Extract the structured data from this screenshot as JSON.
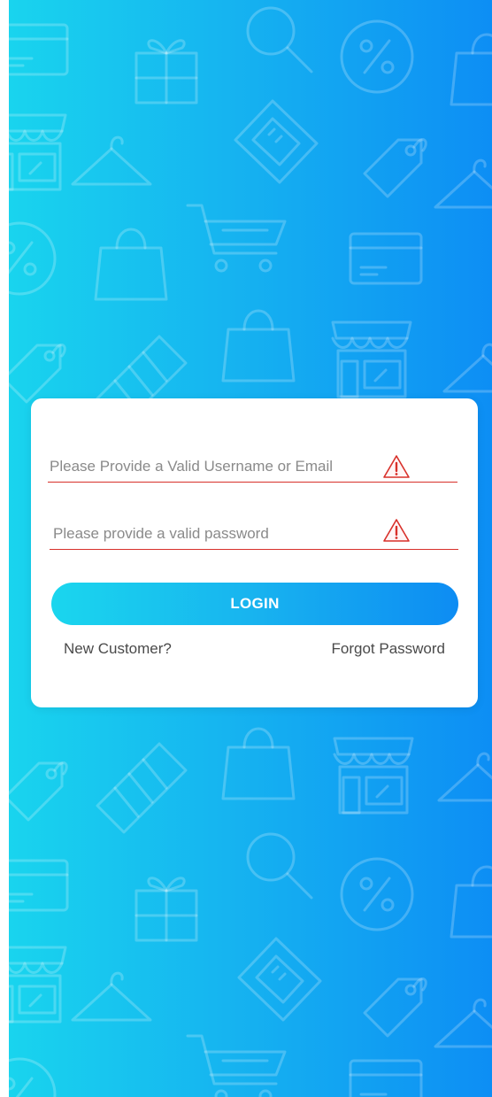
{
  "colors": {
    "background_start": "#19d4ee",
    "background_end": "#0d8ef4",
    "card": "#ffffff",
    "error_underline": "#d8302a",
    "button_start": "#1ad6ee",
    "button_end": "#0d8cf3",
    "link_text": "#4a4a4a"
  },
  "background": {
    "pattern_icons": [
      "credit-card-icon",
      "gift-icon",
      "magnifier-icon",
      "percent-badge-icon",
      "shopping-bag-icon",
      "storefront-icon",
      "clothes-hanger-icon",
      "laptop-icon",
      "price-tag-icon",
      "shopping-cart-icon",
      "striped-tag-icon"
    ]
  },
  "login_form": {
    "username": {
      "value": "",
      "placeholder": "Please Provide a Valid Username or Email",
      "status_icon": "warning-triangle-icon"
    },
    "password": {
      "value": "",
      "placeholder": "Please provide a valid password",
      "status_icon": "warning-triangle-icon"
    },
    "login_label": "LOGIN",
    "new_customer_label": "New Customer?",
    "forgot_password_label": "Forgot Password"
  }
}
